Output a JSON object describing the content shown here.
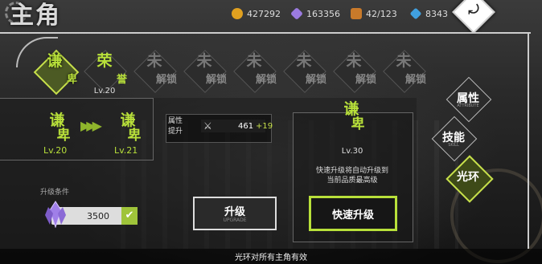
{
  "header": {
    "title": "主角",
    "resources": [
      {
        "icon": "gold-coin-icon",
        "value": "427292",
        "color": "#e0a020"
      },
      {
        "icon": "purple-crystal-icon",
        "value": "163356",
        "color": "#9b7be0"
      },
      {
        "icon": "treasure-chest-icon",
        "value": "42/123",
        "color": "#c97a2a"
      },
      {
        "icon": "blue-diamond-icon",
        "value": "8343",
        "color": "#40a0e0"
      }
    ],
    "back_icon": "back-arrow-icon"
  },
  "ranks": [
    {
      "top": "谦",
      "bottom": "卑",
      "level": "",
      "state": "active"
    },
    {
      "top": "荣",
      "bottom": "誉",
      "level": "Lv.20",
      "state": "earned"
    },
    {
      "top": "未",
      "bottom": "解锁",
      "level": "",
      "state": "locked"
    },
    {
      "top": "未",
      "bottom": "解锁",
      "level": "",
      "state": "locked"
    },
    {
      "top": "未",
      "bottom": "解锁",
      "level": "",
      "state": "locked"
    },
    {
      "top": "未",
      "bottom": "解锁",
      "level": "",
      "state": "locked"
    },
    {
      "top": "未",
      "bottom": "解锁",
      "level": "",
      "state": "locked"
    },
    {
      "top": "未",
      "bottom": "解锁",
      "level": "",
      "state": "locked"
    }
  ],
  "upgrade": {
    "current": {
      "top": "谦",
      "bottom": "卑",
      "level": "Lv.20"
    },
    "next": {
      "top": "谦",
      "bottom": "卑",
      "level": "Lv.21"
    },
    "attr_label": "属性提升",
    "attr_icon": "sword-icon",
    "attr_value": "461",
    "attr_bonus": "+19",
    "condition_label": "升级条件",
    "cost_icon": "purple-crystal-icon",
    "cost_value": "3500",
    "button_label": "升级",
    "button_sub": "UPGRADE"
  },
  "quick": {
    "top": "谦",
    "bottom": "卑",
    "level": "Lv.30",
    "desc_line1": "快速升级将自动升级到",
    "desc_line2": "当前品质最高级",
    "button_label": "快速升级"
  },
  "side_tabs": [
    {
      "label": "属性",
      "sub": "ATTRIBUTE",
      "active": false
    },
    {
      "label": "技能",
      "sub": "SKILL",
      "active": false
    },
    {
      "label": "光环",
      "sub": "",
      "active": true
    }
  ],
  "footer": {
    "text": "光环对所有主角有效"
  },
  "colors": {
    "accent": "#b8e03a",
    "background": "#2a2a2a"
  }
}
